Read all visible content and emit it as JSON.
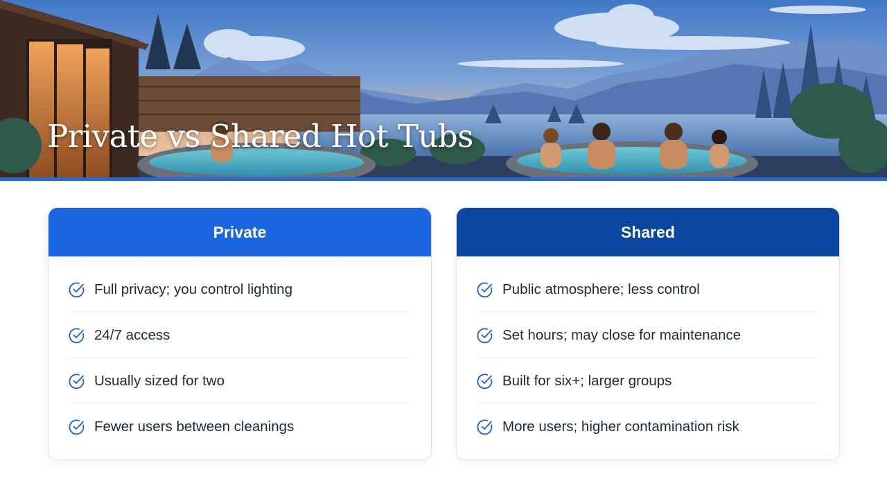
{
  "title": "Private vs Shared Hot Tubs",
  "colors": {
    "accent_bar": "#2268d8",
    "private_header": "#1a66e0",
    "shared_header": "#0a469e",
    "check_icon": "#1d5fd0",
    "item_text": "#1e2a3a"
  },
  "banner": {
    "image_description_icon": "landscape-hot-tub-illustration"
  },
  "cards": [
    {
      "id": "private",
      "header": "Private",
      "items": [
        "Full privacy; you control lighting",
        "24/7 access",
        "Usually sized for two",
        "Fewer users between cleanings"
      ]
    },
    {
      "id": "shared",
      "header": "Shared",
      "items": [
        "Public atmosphere; less control",
        "Set hours; may close for maintenance",
        "Built for six+; larger groups",
        "More users; higher contamination risk"
      ]
    }
  ]
}
